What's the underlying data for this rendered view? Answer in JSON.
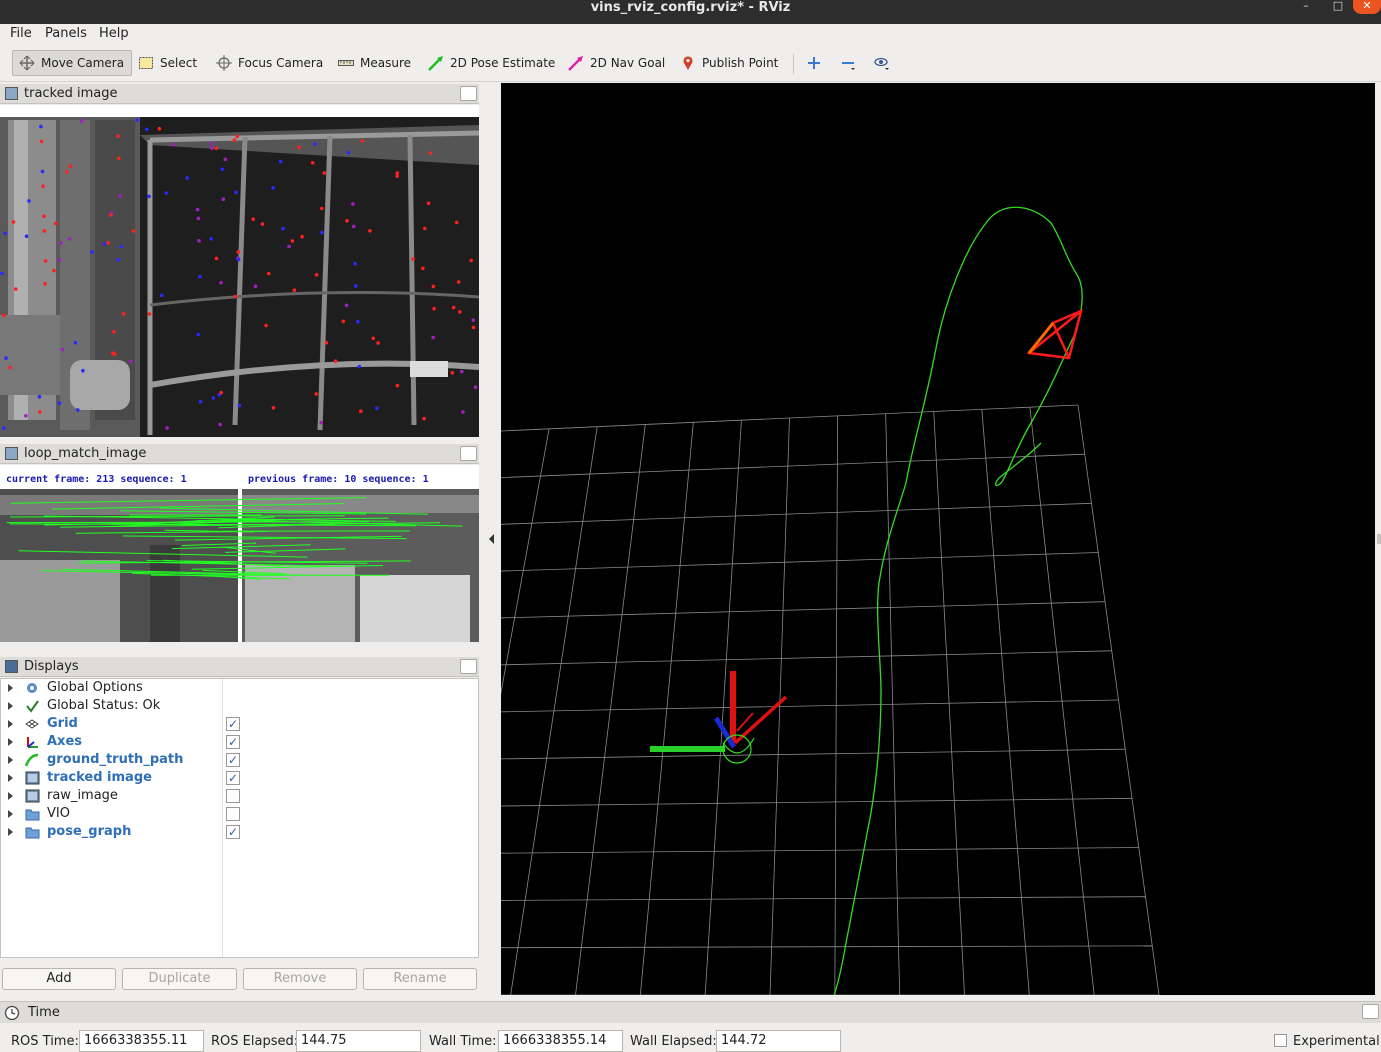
{
  "window": {
    "title": "vins_rviz_config.rviz* - RViz"
  },
  "menu": {
    "file": "File",
    "panels": "Panels",
    "help": "Help"
  },
  "toolbar": {
    "move_camera": "Move Camera",
    "select": "Select",
    "focus_camera": "Focus Camera",
    "measure": "Measure",
    "pose_estimate": "2D Pose Estimate",
    "nav_goal": "2D Nav Goal",
    "publish_point": "Publish Point"
  },
  "panels": {
    "tracked_image": "tracked image",
    "loop_match_image": "loop_match_image",
    "displays": "Displays",
    "time": "Time"
  },
  "loop_match": {
    "left_caption": "current frame: 213   sequence: 1",
    "right_caption": "previous frame: 10   sequence: 1"
  },
  "displays": {
    "items": [
      {
        "label": "Global Options",
        "icon": "gear-icon",
        "checked": null,
        "highlight": false
      },
      {
        "label": "Global Status: Ok",
        "icon": "checkmark-icon",
        "checked": null,
        "highlight": false
      },
      {
        "label": "Grid",
        "icon": "grid-icon",
        "checked": true,
        "highlight": true
      },
      {
        "label": "Axes",
        "icon": "axes-icon",
        "checked": true,
        "highlight": true
      },
      {
        "label": "ground_truth_path",
        "icon": "path-icon",
        "checked": true,
        "highlight": true
      },
      {
        "label": "tracked image",
        "icon": "image-icon",
        "checked": true,
        "highlight": true
      },
      {
        "label": "raw_image",
        "icon": "image-icon",
        "checked": false,
        "highlight": false
      },
      {
        "label": "VIO",
        "icon": "folder-icon",
        "checked": false,
        "highlight": false
      },
      {
        "label": "pose_graph",
        "icon": "folder-icon",
        "checked": true,
        "highlight": true
      }
    ],
    "buttons": {
      "add": "Add",
      "duplicate": "Duplicate",
      "remove": "Remove",
      "rename": "Rename"
    }
  },
  "time": {
    "ros_time_label": "ROS Time:",
    "ros_time": "1666338355.11",
    "ros_elapsed_label": "ROS Elapsed:",
    "ros_elapsed": "144.75",
    "wall_time_label": "Wall Time:",
    "wall_time": "1666338355.14",
    "wall_elapsed_label": "Wall Elapsed:",
    "wall_elapsed": "144.72",
    "experimental_label": "Experimental"
  },
  "colors": {
    "trajectory": "#33dd22",
    "camera_frustum": "#ff1a1a",
    "grid": "#8a8a8a",
    "highlight_text": "#2f6fb7"
  }
}
